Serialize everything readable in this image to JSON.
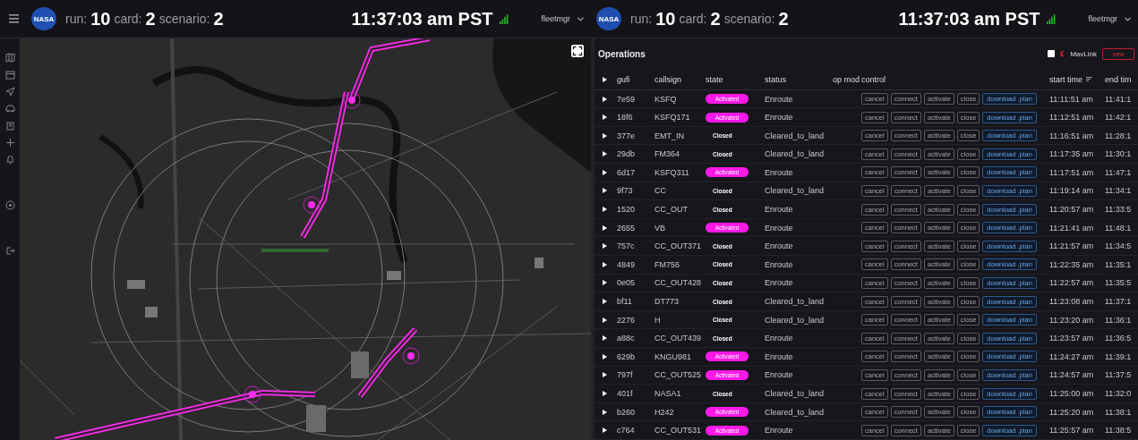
{
  "left_panel": {
    "header": {
      "logo_text": "NASA",
      "run_label": "run:",
      "run": "10",
      "card_label": "card:",
      "card": "2",
      "scenario_label": "scenario:",
      "scenario": "2",
      "clock": "11:37:03 am PST",
      "user": "fleetmgr"
    }
  },
  "right_panel": {
    "header": {
      "logo_text": "NASA",
      "run_label": "run:",
      "run": "10",
      "card_label": "card:",
      "card": "2",
      "scenario_label": "scenario:",
      "scenario": "2",
      "clock": "11:37:03 am PST",
      "user": "fleetmgr"
    },
    "operations": {
      "title": "Operations",
      "mavlink": {
        "label": "MavLink",
        "checked": false
      },
      "new_button": "new",
      "columns": [
        "gufi",
        "callsign",
        "state",
        "status",
        "op mod",
        "control",
        "start time",
        "end tim"
      ],
      "rows": [
        {
          "gufi": "7e59",
          "callsign": "KSFQ",
          "state": {
            "label": "Activated",
            "kind": "active"
          },
          "status": "Enroute",
          "controls": [
            "cancel",
            "connect",
            "activate",
            "close",
            "download .plan"
          ],
          "start": "11:11:51 am",
          "end": "11:41:1"
        },
        {
          "gufi": "18f6",
          "callsign": "KSFQ171",
          "state": {
            "label": "Activated",
            "kind": "active"
          },
          "status": "Enroute",
          "controls": [
            "cancel",
            "connect",
            "activate",
            "close",
            "download .plan"
          ],
          "start": "11:12:51 am",
          "end": "11:42:1"
        },
        {
          "gufi": "377e",
          "callsign": "EMT_IN",
          "state": {
            "label": "Closed",
            "kind": "closed"
          },
          "status": "Cleared_to_land",
          "controls": [
            "cancel",
            "connect",
            "activate",
            "close",
            "download .plan"
          ],
          "start": "11:16:51 am",
          "end": "11:28:1"
        },
        {
          "gufi": "29db",
          "callsign": "FM364",
          "state": {
            "label": "Closed",
            "kind": "closed"
          },
          "status": "Cleared_to_land",
          "controls": [
            "cancel",
            "connect",
            "activate",
            "close",
            "download .plan"
          ],
          "start": "11:17:35 am",
          "end": "11:30:1"
        },
        {
          "gufi": "6d17",
          "callsign": "KSFQ311",
          "state": {
            "label": "Activated",
            "kind": "active"
          },
          "status": "Enroute",
          "controls": [
            "cancel",
            "connect",
            "activate",
            "close",
            "download .plan"
          ],
          "start": "11:17:51 am",
          "end": "11:47:1"
        },
        {
          "gufi": "9f73",
          "callsign": "CC",
          "state": {
            "label": "Closed",
            "kind": "closed"
          },
          "status": "Cleared_to_land",
          "controls": [
            "cancel",
            "connect",
            "activate",
            "close",
            "download .plan"
          ],
          "start": "11:19:14 am",
          "end": "11:34:1"
        },
        {
          "gufi": "1520",
          "callsign": "CC_OUT",
          "state": {
            "label": "Closed",
            "kind": "closed"
          },
          "status": "Enroute",
          "controls": [
            "cancel",
            "connect",
            "activate",
            "close",
            "download .plan"
          ],
          "start": "11:20:57 am",
          "end": "11:33:5"
        },
        {
          "gufi": "2655",
          "callsign": "VB",
          "state": {
            "label": "Activated",
            "kind": "active"
          },
          "status": "Enroute",
          "controls": [
            "cancel",
            "connect",
            "activate",
            "close",
            "download .plan"
          ],
          "start": "11:21:41 am",
          "end": "11:48:1"
        },
        {
          "gufi": "757c",
          "callsign": "CC_OUT371",
          "state": {
            "label": "Closed",
            "kind": "closed"
          },
          "status": "Enroute",
          "controls": [
            "cancel",
            "connect",
            "activate",
            "close",
            "download .plan"
          ],
          "start": "11:21:57 am",
          "end": "11:34:5"
        },
        {
          "gufi": "4849",
          "callsign": "FM756",
          "state": {
            "label": "Closed",
            "kind": "closed"
          },
          "status": "Enroute",
          "controls": [
            "cancel",
            "connect",
            "activate",
            "close",
            "download .plan"
          ],
          "start": "11:22:35 am",
          "end": "11:35:1"
        },
        {
          "gufi": "0e05",
          "callsign": "CC_OUT428",
          "state": {
            "label": "Closed",
            "kind": "closed"
          },
          "status": "Enroute",
          "controls": [
            "cancel",
            "connect",
            "activate",
            "close",
            "download .plan"
          ],
          "start": "11:22:57 am",
          "end": "11:35:5"
        },
        {
          "gufi": "bf11",
          "callsign": "DT773",
          "state": {
            "label": "Closed",
            "kind": "closed"
          },
          "status": "Cleared_to_land",
          "controls": [
            "cancel",
            "connect",
            "activate",
            "close",
            "download .plan"
          ],
          "start": "11:23:08 am",
          "end": "11:37:1"
        },
        {
          "gufi": "2276",
          "callsign": "H",
          "state": {
            "label": "Closed",
            "kind": "closed"
          },
          "status": "Cleared_to_land",
          "controls": [
            "cancel",
            "connect",
            "activate",
            "close",
            "download .plan"
          ],
          "start": "11:23:20 am",
          "end": "11:36:1"
        },
        {
          "gufi": "a88c",
          "callsign": "CC_OUT439",
          "state": {
            "label": "Closed",
            "kind": "closed"
          },
          "status": "Enroute",
          "controls": [
            "cancel",
            "connect",
            "activate",
            "close",
            "download .plan"
          ],
          "start": "11:23:57 am",
          "end": "11:36:5"
        },
        {
          "gufi": "629b",
          "callsign": "KNGU981",
          "state": {
            "label": "Activated",
            "kind": "active"
          },
          "status": "Enroute",
          "controls": [
            "cancel",
            "connect",
            "activate",
            "close",
            "download .plan"
          ],
          "start": "11:24:27 am",
          "end": "11:39:1"
        },
        {
          "gufi": "797f",
          "callsign": "CC_OUT525",
          "state": {
            "label": "Activated",
            "kind": "active"
          },
          "status": "Enroute",
          "controls": [
            "cancel",
            "connect",
            "activate",
            "close",
            "download .plan"
          ],
          "start": "11:24:57 am",
          "end": "11:37:5"
        },
        {
          "gufi": "401f",
          "callsign": "NASA1",
          "state": {
            "label": "Closed",
            "kind": "closed"
          },
          "status": "Cleared_to_land",
          "controls": [
            "cancel",
            "connect",
            "activate",
            "close",
            "download .plan"
          ],
          "start": "11:25:00 am",
          "end": "11:32:0"
        },
        {
          "gufi": "b260",
          "callsign": "H242",
          "state": {
            "label": "Activated",
            "kind": "active"
          },
          "status": "Cleared_to_land",
          "controls": [
            "cancel",
            "connect",
            "activate",
            "close",
            "download .plan"
          ],
          "start": "11:25:20 am",
          "end": "11:38:1"
        },
        {
          "gufi": "c764",
          "callsign": "CC_OUT531",
          "state": {
            "label": "Activated",
            "kind": "active"
          },
          "status": "Enroute",
          "controls": [
            "cancel",
            "connect",
            "activate",
            "close",
            "download .plan"
          ],
          "start": "11:25:57 am",
          "end": "11:38:5"
        }
      ]
    }
  }
}
